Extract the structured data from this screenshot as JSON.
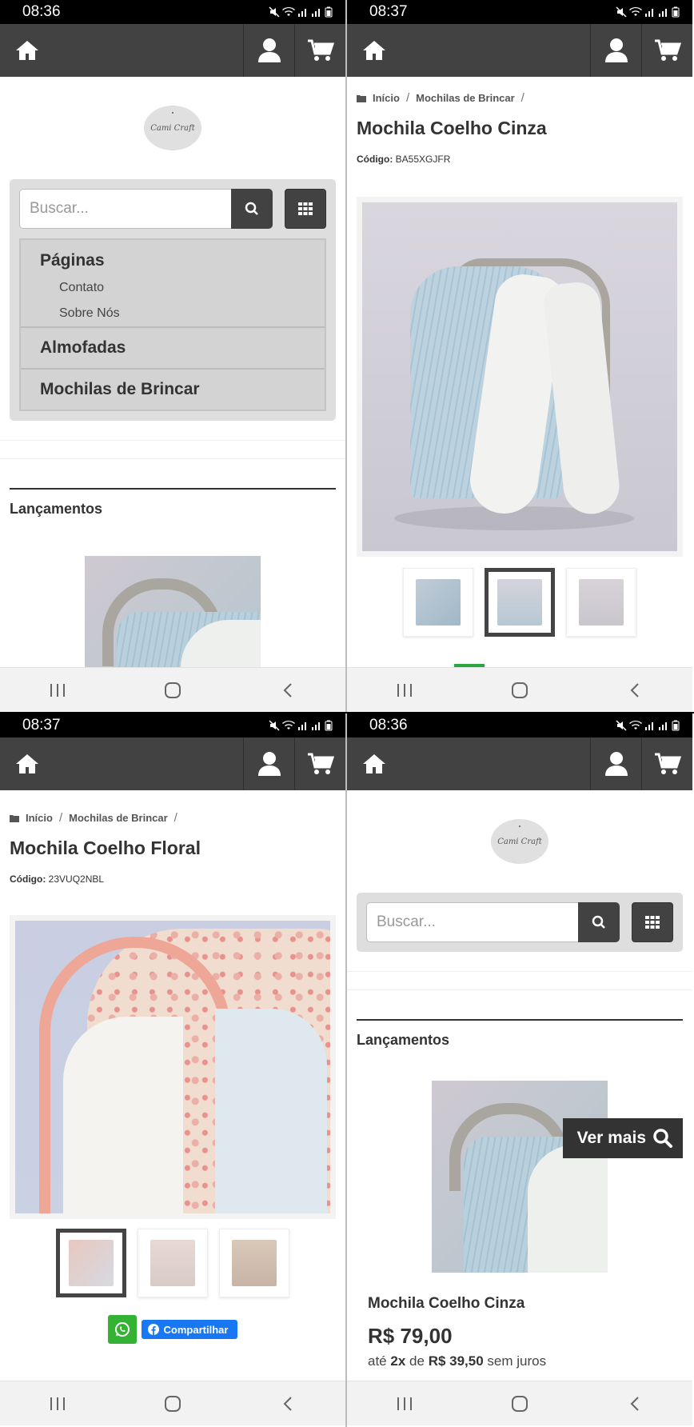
{
  "screens": {
    "home_menu": {
      "time": "08:36",
      "logo_text": "Cami Craft",
      "search_placeholder": "Buscar...",
      "menu": {
        "pages_header": "Páginas",
        "pages": [
          "Contato",
          "Sobre Nós"
        ],
        "categories": [
          "Almofadas",
          "Mochilas de Brincar"
        ]
      },
      "section_title": "Lançamentos"
    },
    "product_gray": {
      "time": "08:37",
      "breadcrumb": [
        "Início",
        "Mochilas de Brincar"
      ],
      "title": "Mochila Coelho Cinza",
      "code_label": "Código:",
      "code_value": "BA55XGJFR",
      "thumbnails_count": 3,
      "active_thumbnail": 2
    },
    "product_floral": {
      "time": "08:37",
      "breadcrumb": [
        "Início",
        "Mochilas de Brincar"
      ],
      "title": "Mochila Coelho Floral",
      "code_label": "Código:",
      "code_value": "23VUQ2NBL",
      "thumbnails_count": 3,
      "active_thumbnail": 1,
      "share_label": "Compartilhar"
    },
    "home_product": {
      "time": "08:36",
      "logo_text": "Cami Craft",
      "search_placeholder": "Buscar...",
      "section_title": "Lançamentos",
      "ver_mais_label": "Ver mais",
      "product_name": "Mochila Coelho Cinza",
      "price": "R$ 79,00",
      "installment_prefix": "até",
      "installment_count": "2x",
      "installment_mid": "de",
      "installment_value": "R$ 39,50",
      "installment_suffix": "sem juros"
    }
  },
  "colors": {
    "navbar": "#424242",
    "accent_green": "#28a745",
    "whatsapp": "#34b233",
    "facebook": "#1877f2"
  }
}
